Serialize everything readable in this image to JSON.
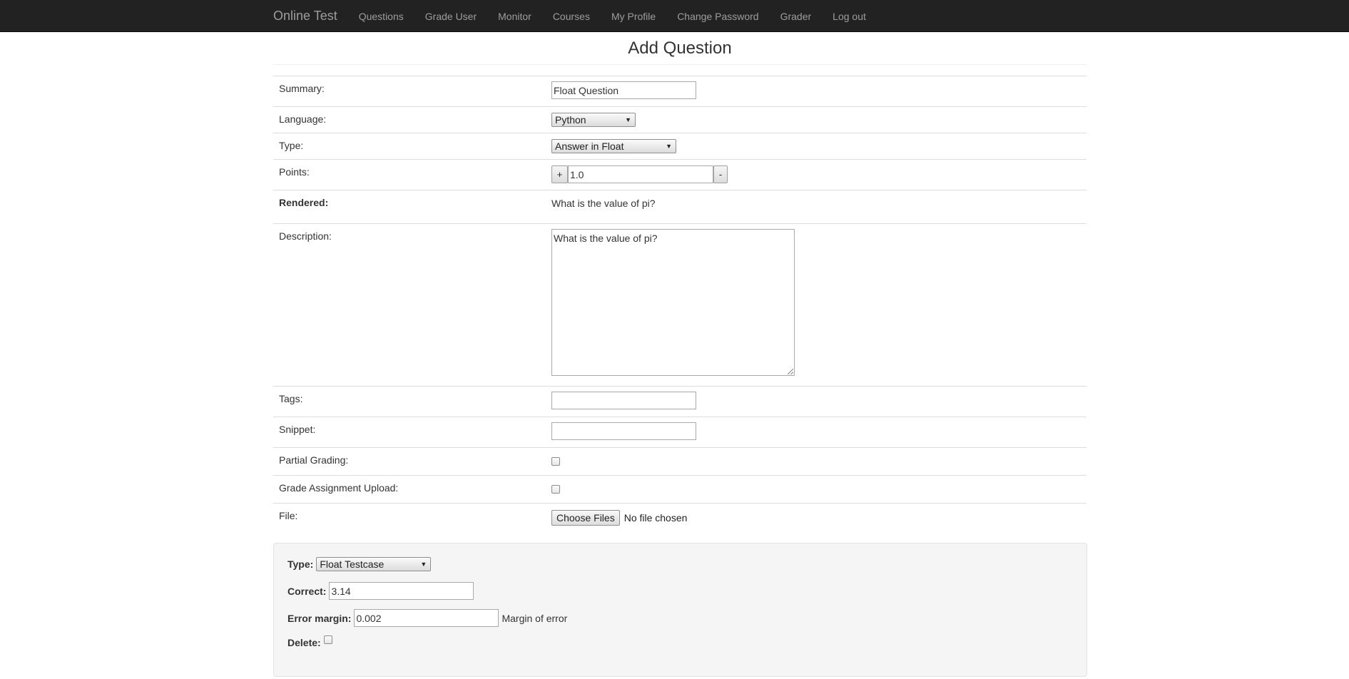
{
  "navbar": {
    "brand": "Online Test",
    "items": [
      "Questions",
      "Grade User",
      "Monitor",
      "Courses",
      "My Profile",
      "Change Password",
      "Grader",
      "Log out"
    ]
  },
  "page": {
    "title": "Add Question"
  },
  "form": {
    "summary": {
      "label": "Summary:",
      "value": "Float Question"
    },
    "language": {
      "label": "Language:",
      "selected": "Python"
    },
    "type": {
      "label": "Type:",
      "selected": "Answer in Float"
    },
    "points": {
      "label": "Points:",
      "value": "1.0",
      "plus": "+",
      "minus": "-"
    },
    "rendered": {
      "label": "Rendered:",
      "text": "What is the value of pi?"
    },
    "description": {
      "label": "Description:",
      "value": "What is the value of pi?"
    },
    "tags": {
      "label": "Tags:",
      "value": ""
    },
    "snippet": {
      "label": "Snippet:",
      "value": ""
    },
    "partial_grading": {
      "label": "Partial Grading:",
      "checked": false
    },
    "grade_assignment_upload": {
      "label": "Grade Assignment Upload:",
      "checked": false
    },
    "file": {
      "label": "File:",
      "button": "Choose Files",
      "status": "No file chosen"
    }
  },
  "testcase": {
    "type": {
      "label": "Type:",
      "selected": "Float Testcase"
    },
    "correct": {
      "label": "Correct:",
      "value": "3.14"
    },
    "error_margin": {
      "label": "Error margin:",
      "value": "0.002",
      "hint": "Margin of error"
    },
    "delete": {
      "label": "Delete:",
      "checked": false
    }
  }
}
